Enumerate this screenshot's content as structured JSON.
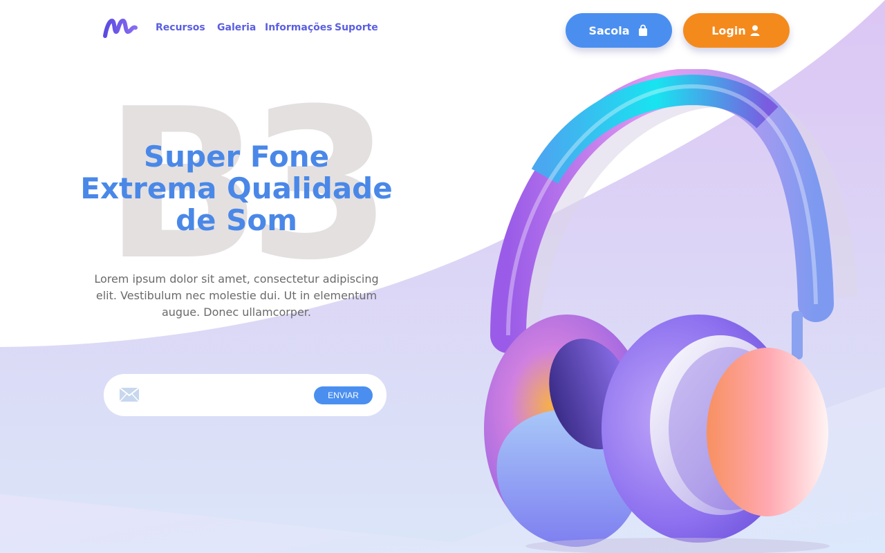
{
  "nav": {
    "items": [
      {
        "label": "Recursos"
      },
      {
        "label": "Galeria"
      },
      {
        "label": "Informações"
      },
      {
        "label": "Suporte"
      }
    ]
  },
  "header": {
    "bag_label": "Sacola",
    "login_label": "Login",
    "bag_icon": "shopping-bag-icon",
    "login_icon": "user-icon"
  },
  "hero": {
    "watermark": "B3",
    "headline": [
      "Super Fone",
      "Extrema Qualidade",
      "de Som"
    ],
    "description": "Lorem ipsum dolor sit amet, consectetur adipiscing elit. Vestibulum nec molestie dui. Ut in elementum augue. Donec ullamcorper.",
    "image": "headphones-illustration"
  },
  "newsletter": {
    "placeholder": "",
    "button_label": "ENVIAR",
    "icon": "mail-icon"
  },
  "colors": {
    "primary_blue": "#4a8ff0",
    "accent_orange": "#f48a1c",
    "nav_purple": "#5b5fe0",
    "wave_lavender": "#dcc8f6"
  }
}
